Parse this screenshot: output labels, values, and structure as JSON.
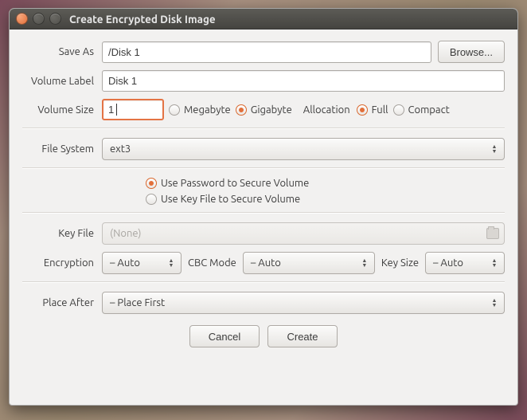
{
  "window": {
    "title": "Create Encrypted Disk Image"
  },
  "labels": {
    "save_as": "Save As",
    "volume_label": "Volume Label",
    "volume_size": "Volume Size",
    "allocation": "Allocation",
    "file_system": "File System",
    "key_file": "Key File",
    "encryption": "Encryption",
    "cbc_mode": "CBC Mode",
    "key_size": "Key Size",
    "place_after": "Place After"
  },
  "fields": {
    "save_as_value": "/Disk 1",
    "volume_label_value": "Disk 1",
    "volume_size_value": "1",
    "key_file_placeholder": "(None)",
    "browse_label": "Browse..."
  },
  "size_unit": {
    "options": {
      "mb": "Megabyte",
      "gb": "Gigabyte"
    },
    "selected": "gb"
  },
  "allocation": {
    "options": {
      "full": "Full",
      "compact": "Compact"
    },
    "selected": "full"
  },
  "security": {
    "password": "Use Password to Secure Volume",
    "keyfile": "Use Key File to Secure Volume",
    "selected": "password"
  },
  "combos": {
    "file_system": "ext3",
    "encryption": "– Auto",
    "cbc_mode": "– Auto",
    "key_size": "– Auto",
    "place_after": "– Place First"
  },
  "buttons": {
    "cancel": "Cancel",
    "create": "Create"
  }
}
